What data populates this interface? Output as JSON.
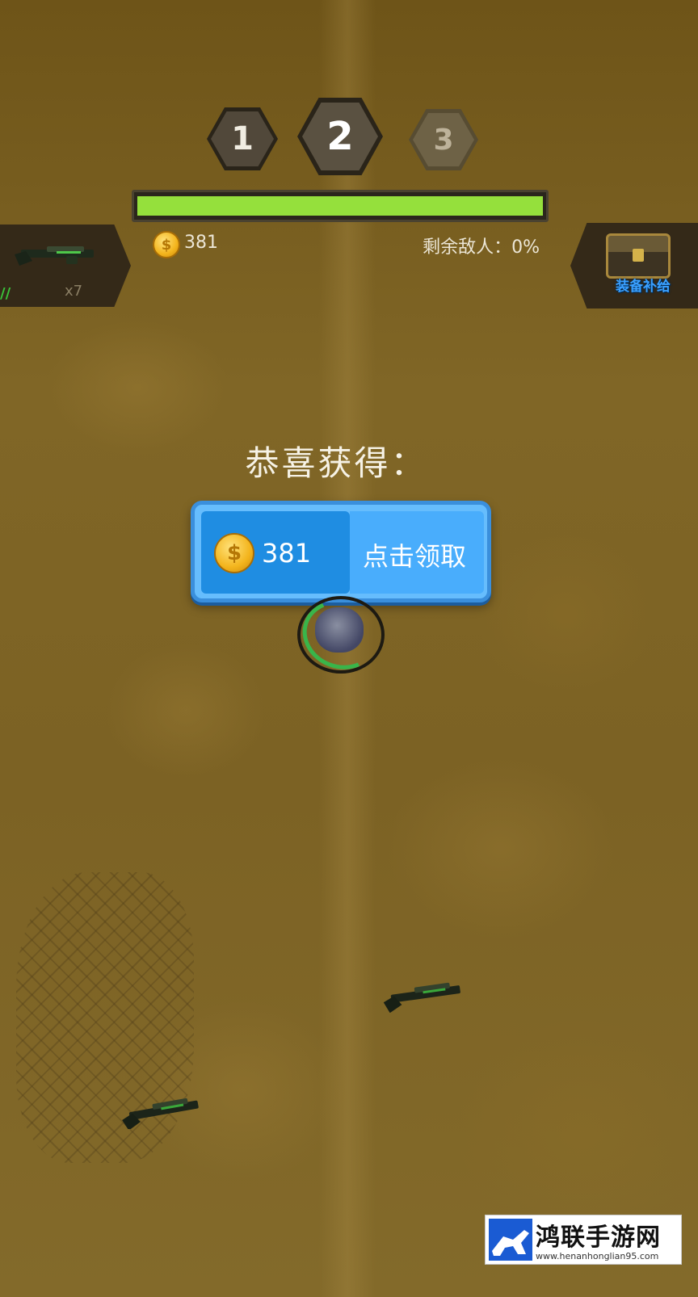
{
  "level_stages": [
    {
      "label": "1",
      "state": "completed"
    },
    {
      "label": "2",
      "state": "current"
    },
    {
      "label": "3",
      "state": "locked"
    }
  ],
  "hud": {
    "level_progress": 1.0,
    "coin_count": "381",
    "enemies_remaining": "剩余敌人：0%",
    "progress_color": "#95e03c"
  },
  "weapon_slot": {
    "icon": "shotgun-icon",
    "count": "x7"
  },
  "supply": {
    "icon": "treasure-chest-icon",
    "label": "装备补给"
  },
  "reward": {
    "title": "恭喜获得：",
    "amount": "381",
    "claim_label": "点击领取",
    "icon": "gold-coin-icon"
  },
  "watermark": {
    "title": "鸿联手游网",
    "url": "www.henanhonglian95.com"
  }
}
